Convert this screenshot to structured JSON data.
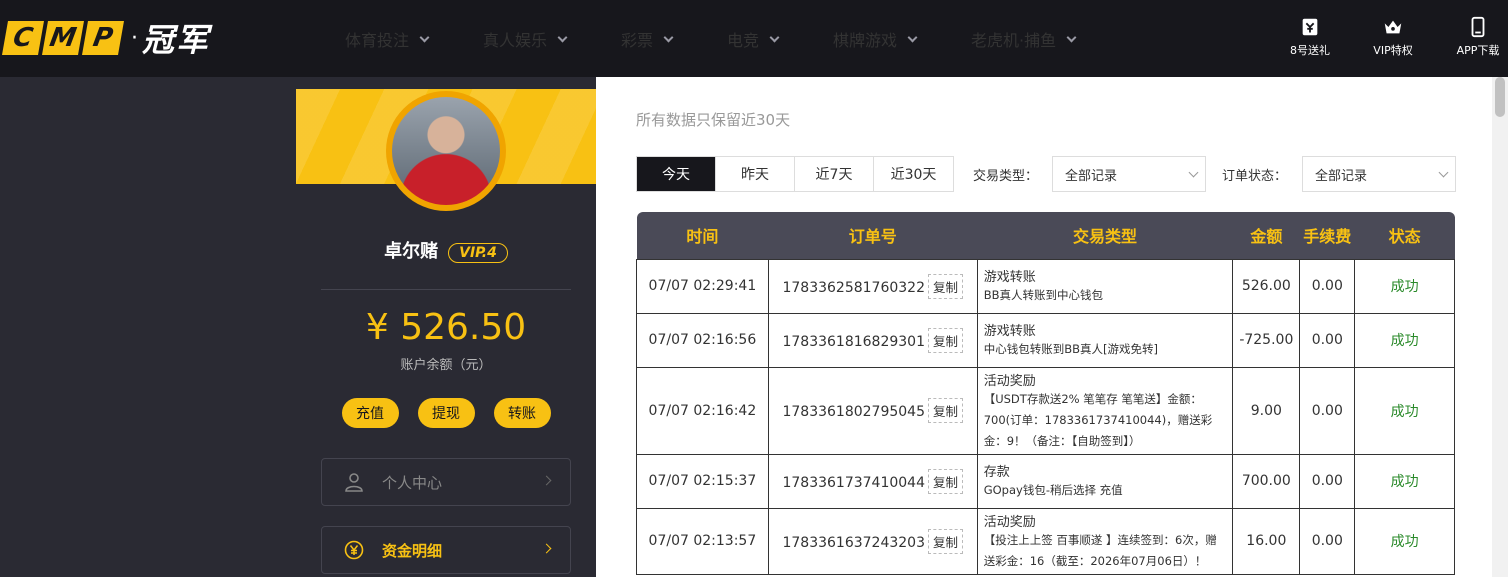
{
  "logo": {
    "brand": "CMP",
    "letters": [
      "C",
      "M",
      "P"
    ],
    "dot": "·",
    "cn": "冠军"
  },
  "nav": [
    {
      "label": "体育投注"
    },
    {
      "label": "真人娱乐"
    },
    {
      "label": "彩票"
    },
    {
      "label": "电竞"
    },
    {
      "label": "棋牌游戏"
    },
    {
      "label": "老虎机·捕鱼"
    }
  ],
  "tools": [
    {
      "label": "8号送礼",
      "icon": "ticket-icon"
    },
    {
      "label": "VIP特权",
      "icon": "crown-icon"
    },
    {
      "label": "APP下载",
      "icon": "phone-icon"
    }
  ],
  "user": {
    "name": "卓尔赌",
    "vip": "VIP.4",
    "balance": "¥ 526.50",
    "balance_label": "账户余额（元）"
  },
  "actions": {
    "deposit": "充值",
    "withdraw": "提现",
    "transfer": "转账"
  },
  "menu": [
    {
      "label": "个人中心",
      "icon": "user-icon",
      "active": false
    },
    {
      "label": "资金明细",
      "icon": "yuan-coin-icon",
      "active": true
    }
  ],
  "main": {
    "subtitle": "所有数据只保留近30天",
    "tabs": [
      {
        "label": "今天",
        "active": true
      },
      {
        "label": "昨天",
        "active": false
      },
      {
        "label": "近7天",
        "active": false
      },
      {
        "label": "近30天",
        "active": false
      }
    ],
    "filters": {
      "type_label": "交易类型：",
      "type_value": "全部记录",
      "status_label": "订单状态：",
      "status_value": "全部记录"
    },
    "table": {
      "headers": [
        "时间",
        "订单号",
        "交易类型",
        "金额",
        "手续费",
        "状态"
      ],
      "copy_label": "复制",
      "rows": [
        {
          "time": "07/07 02:29:41",
          "order": "1783362581760322",
          "type": "游戏转账",
          "detail": "BB真人转账到中心钱包",
          "amount": "526.00",
          "fee": "0.00",
          "status": "成功"
        },
        {
          "time": "07/07 02:16:56",
          "order": "1783361816829301",
          "type": "游戏转账",
          "detail": "中心钱包转账到BB真人[游戏免转]",
          "amount": "-725.00",
          "fee": "0.00",
          "status": "成功"
        },
        {
          "time": "07/07 02:16:42",
          "order": "1783361802795045",
          "type": "活动奖励",
          "detail": "【USDT存款送2% 笔笔存 笔笔送】金额：700(订单：1783361737410044)，赠送彩金：9！（备注：【自助签到】）",
          "amount": "9.00",
          "fee": "0.00",
          "status": "成功"
        },
        {
          "time": "07/07 02:15:37",
          "order": "1783361737410044",
          "type": "存款",
          "detail": "GOpay钱包-稍后选择 充值",
          "amount": "700.00",
          "fee": "0.00",
          "status": "成功"
        },
        {
          "time": "07/07 02:13:57",
          "order": "1783361637243203",
          "type": "活动奖励",
          "detail": "【投注上上签 百事顺遂 】连续签到：6次，赠送彩金：16（截至：2026年07月06日）！",
          "amount": "16.00",
          "fee": "0.00",
          "status": "成功"
        }
      ]
    }
  },
  "colors": {
    "accent": "#f8c113",
    "nav_bg": "#17171c",
    "side_bg": "#2a2a33",
    "header_bg": "#4a4a57",
    "success": "#2a8a2a"
  }
}
